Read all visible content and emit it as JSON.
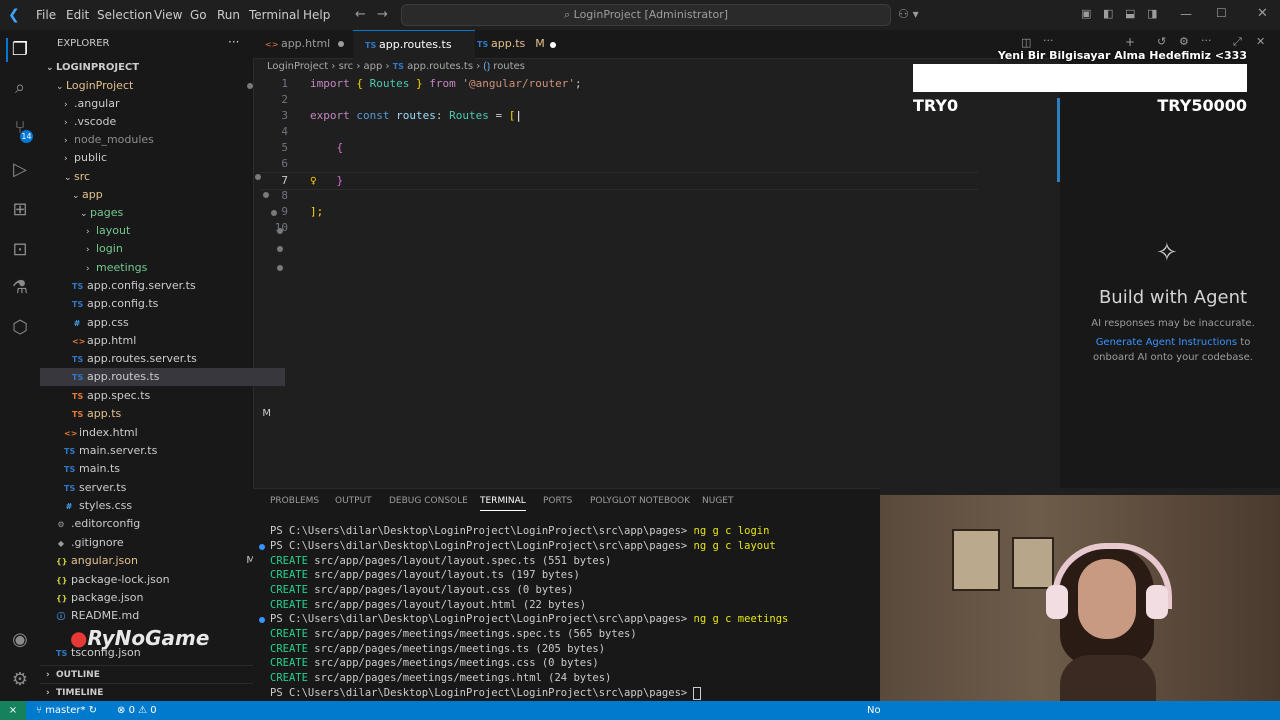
{
  "titlebar": {
    "menu": [
      "File",
      "Edit",
      "Selection",
      "View",
      "Go",
      "Run",
      "Terminal",
      "Help"
    ],
    "search": "LoginProject [Administrator]"
  },
  "sidebar": {
    "header": "EXPLORER",
    "root": "LOGINPROJECT",
    "items": [
      {
        "label": "LoginProject"
      },
      {
        "label": ".angular"
      },
      {
        "label": ".vscode"
      },
      {
        "label": "node_modules"
      },
      {
        "label": "public"
      },
      {
        "label": "src"
      },
      {
        "label": "app"
      },
      {
        "label": "pages"
      },
      {
        "label": "layout"
      },
      {
        "label": "login"
      },
      {
        "label": "meetings"
      },
      {
        "label": "app.config.server.ts"
      },
      {
        "label": "app.config.ts"
      },
      {
        "label": "app.css"
      },
      {
        "label": "app.html"
      },
      {
        "label": "app.routes.server.ts"
      },
      {
        "label": "app.routes.ts"
      },
      {
        "label": "app.spec.ts"
      },
      {
        "label": "app.ts",
        "badge": "M"
      },
      {
        "label": "index.html"
      },
      {
        "label": "main.server.ts"
      },
      {
        "label": "main.ts"
      },
      {
        "label": "server.ts"
      },
      {
        "label": "styles.css"
      },
      {
        "label": ".editorconfig"
      },
      {
        "label": ".gitignore"
      },
      {
        "label": "angular.json",
        "badge": "M"
      },
      {
        "label": "package-lock.json"
      },
      {
        "label": "package.json"
      },
      {
        "label": "README.md"
      },
      {
        "label": "tsconfig.json"
      }
    ],
    "outline": "OUTLINE",
    "timeline": "TIMELINE"
  },
  "tabs": [
    {
      "label": "app.html"
    },
    {
      "label": "app.routes.ts"
    },
    {
      "label": "app.ts",
      "badge": "M"
    }
  ],
  "breadcrumb": {
    "parts": [
      "LoginProject",
      "src",
      "app",
      "app.routes.ts",
      "routes"
    ]
  },
  "editor": {
    "lines": [
      "1",
      "2",
      "3",
      "4",
      "5",
      "6",
      "7",
      "8",
      "9",
      "10"
    ],
    "l1": {
      "a": "import",
      "b": "{",
      "c": "Routes",
      "d": "}",
      "e": "from",
      "f": "'@angular/router'",
      "g": ";"
    },
    "l3": {
      "a": "export",
      "b": "const",
      "c": "routes",
      "d": ":",
      "e": "Routes",
      "f": "=",
      "g": "["
    },
    "l5": "{",
    "l7": "}",
    "l9": "];"
  },
  "panel": {
    "tabs": [
      "PROBLEMS",
      "OUTPUT",
      "DEBUG CONSOLE",
      "TERMINAL",
      "PORTS",
      "POLYGLOT NOTEBOOK",
      "NUGET"
    ],
    "terminal": [
      {
        "prompt": "PS C:\\Users\\dilar\\Desktop\\LoginProject\\LoginProject\\src\\app\\pages>",
        "cmd": " ng g c login"
      },
      {
        "prompt": "PS C:\\Users\\dilar\\Desktop\\LoginProject\\LoginProject\\src\\app\\pages>",
        "cmd": " ng g c layout"
      },
      {
        "create": "CREATE",
        "text": " src/app/pages/layout/layout.spec.ts (551 bytes)"
      },
      {
        "create": "CREATE",
        "text": " src/app/pages/layout/layout.ts (197 bytes)"
      },
      {
        "create": "CREATE",
        "text": " src/app/pages/layout/layout.css (0 bytes)"
      },
      {
        "create": "CREATE",
        "text": " src/app/pages/layout/layout.html (22 bytes)"
      },
      {
        "prompt": "PS C:\\Users\\dilar\\Desktop\\LoginProject\\LoginProject\\src\\app\\pages>",
        "cmd": " ng g c meetings"
      },
      {
        "create": "CREATE",
        "text": " src/app/pages/meetings/meetings.spec.ts (565 bytes)"
      },
      {
        "create": "CREATE",
        "text": " src/app/pages/meetings/meetings.ts (205 bytes)"
      },
      {
        "create": "CREATE",
        "text": " src/app/pages/meetings/meetings.css (0 bytes)"
      },
      {
        "create": "CREATE",
        "text": " src/app/pages/meetings/meetings.html (24 bytes)"
      },
      {
        "prompt": "PS C:\\Users\\dilar\\Desktop\\LoginProject\\LoginProject\\src\\app\\pages>",
        "cmd": ""
      }
    ]
  },
  "chat": {
    "title": "Build with Agent",
    "disclaimer": "AI responses may be inaccurate.",
    "link": "Generate Agent Instructions",
    "link_suffix": " to",
    "line2": "onboard AI onto your codebase."
  },
  "overlay": {
    "goal": "Yeni Bir Bilgisayar Alma Hedefimiz <333",
    "min": "TRY0",
    "max": "TRY50000",
    "watermark": "RyNoGame"
  },
  "statusbar": {
    "branch": "master*",
    "errors": "0",
    "warnings": "0",
    "right": "No"
  }
}
